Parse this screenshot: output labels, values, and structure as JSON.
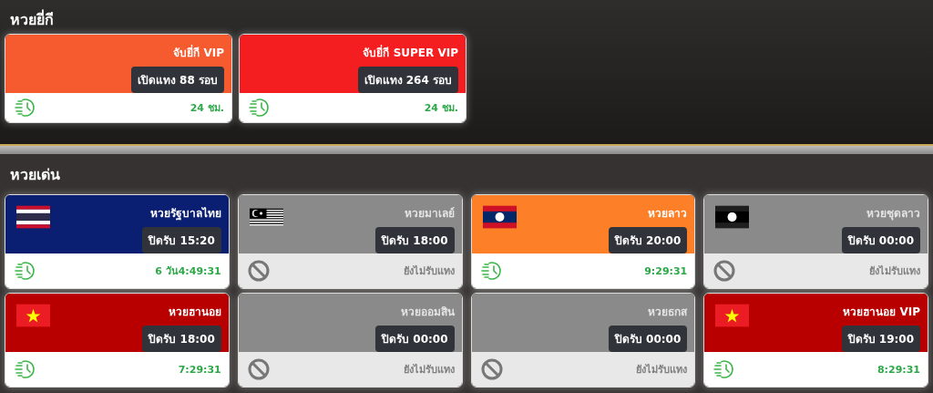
{
  "sections": [
    {
      "title": "หวยยี่กี",
      "cards": [
        {
          "kind": "plain",
          "name": "จับยี่กี VIP",
          "badge": "เปิดแทง 88 รอบ",
          "status": "24 ชม.",
          "open": true,
          "color": "#f55b2e"
        },
        {
          "kind": "plain",
          "name": "จับยี่กี SUPER VIP",
          "badge": "เปิดแทง 264 รอบ",
          "status": "24 ชม.",
          "open": true,
          "color": "#f41d1f"
        }
      ]
    },
    {
      "title": "หวยเด่น",
      "cards": [
        {
          "kind": "thailand",
          "name": "หวยรัฐบาลไทย",
          "badge": "ปิดรับ 15:20",
          "status": "6 วัน4:49:31",
          "open": true,
          "color": "#0b1f72"
        },
        {
          "kind": "malaysia",
          "name": "หวยมาเลย์",
          "badge": "ปิดรับ 18:00",
          "status": "ยังไม่รับแทง",
          "open": false,
          "color": "#8a8a8a"
        },
        {
          "kind": "laos",
          "name": "หวยลาว",
          "badge": "ปิดรับ 20:00",
          "status": "9:29:31",
          "open": true,
          "color": "#fd7f27"
        },
        {
          "kind": "laos",
          "name": "หวยชุดลาว",
          "badge": "ปิดรับ 00:00",
          "status": "ยังไม่รับแทง",
          "open": false,
          "color": "#8a8a8a"
        },
        {
          "kind": "vietnam",
          "name": "หวยฮานอย",
          "badge": "ปิดรับ 18:00",
          "status": "7:29:31",
          "open": true,
          "color": "#b80000"
        },
        {
          "kind": "plain",
          "name": "หวยออมสิน",
          "badge": "ปิดรับ 00:00",
          "status": "ยังไม่รับแทง",
          "open": false,
          "color": "#8a8a8a"
        },
        {
          "kind": "plain",
          "name": "หวยธกส",
          "badge": "ปิดรับ 00:00",
          "status": "ยังไม่รับแทง",
          "open": false,
          "color": "#8a8a8a"
        },
        {
          "kind": "vietnam",
          "name": "หวยฮานอย VIP",
          "badge": "ปิดรับ 19:00",
          "status": "8:29:31",
          "open": true,
          "color": "#b80000"
        }
      ]
    }
  ]
}
